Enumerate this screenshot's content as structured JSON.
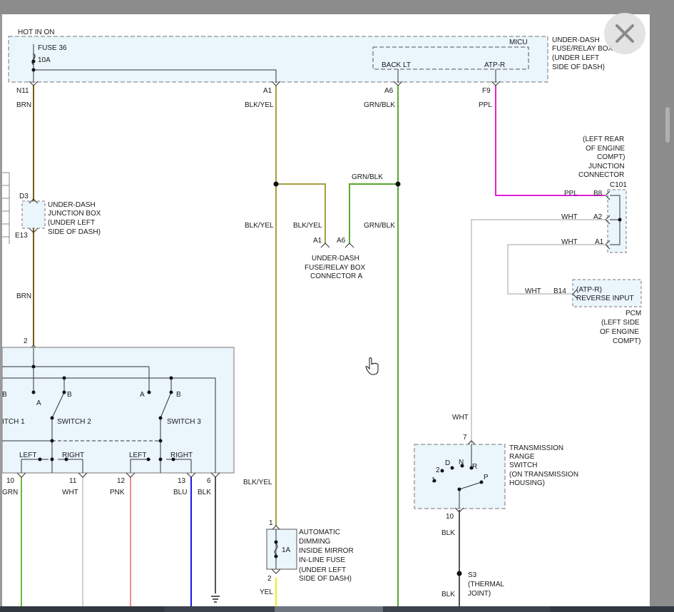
{
  "colors": {
    "brn": "#7a5a14",
    "blk_yel": "#a3a03a",
    "grn_blk": "#5aa832",
    "ppl": "#e020d8",
    "wht": "#d0d0d0",
    "grn": "#6ab83a",
    "pnk": "#f08a90",
    "blu": "#1a1ae6",
    "blk": "#555555",
    "yel": "#f2ec1e",
    "box_fill": "#eaf5fc",
    "box_stroke": "#777777"
  },
  "fuse_box": {
    "hot_label": "HOT IN ON",
    "fuse": "FUSE 36",
    "rating": "10A",
    "micu": "MICU",
    "back_lt": "BACK LT",
    "atp_r": "ATP-R",
    "desc": [
      "UNDER-DASH",
      "FUSE/RELAY BOX",
      "(UNDER LEFT",
      "SIDE OF DASH)"
    ]
  },
  "terminals": {
    "n11": "N11",
    "a1": "A1",
    "a6": "A6",
    "f9": "F9",
    "d3": "D3",
    "e13": "E13",
    "t2": "2",
    "c_a1": "A1",
    "c_a6": "A6",
    "c101": "C101",
    "b8": "B8",
    "a2": "A2",
    "cpin_a1": "A1",
    "b14": "B14",
    "m1": "1",
    "m2": "2",
    "t10": "10",
    "t11": "11",
    "t12": "12",
    "t13": "13",
    "t6": "6",
    "tr7": "7",
    "tr10": "10"
  },
  "wires": {
    "brn_top": "BRN",
    "brn_mid": "BRN",
    "blk_yel_top": "BLK/YEL",
    "blk_yel_mid": "BLK/YEL",
    "blk_yel_branch": "BLK/YEL",
    "blk_yel_low": "BLK/YEL",
    "grn_blk_top": "GRN/BLK",
    "grn_blk_branch": "GRN/BLK",
    "grn_blk_mid": "GRN/BLK",
    "ppl_top": "PPL",
    "ppl_c101": "PPL",
    "wht_a2": "WHT",
    "wht_a1": "WHT",
    "wht_b14": "WHT",
    "wht_tr": "WHT",
    "grn": "GRN",
    "wht": "WHT",
    "pnk": "PNK",
    "blu": "BLU",
    "blk": "BLK",
    "blk_tr": "BLK",
    "blk_s3": "BLK",
    "yel": "YEL"
  },
  "junction_box": [
    "UNDER-DASH",
    "JUNCTION BOX",
    "(UNDER LEFT",
    "SIDE OF DASH)"
  ],
  "connector_a": [
    "UNDER-DASH",
    "FUSE/RELAY BOX",
    "CONNECTOR A"
  ],
  "junction_connector": [
    "(LEFT REAR",
    "OF ENGINE",
    "COMPT)",
    "JUNCTION",
    "CONNECTOR"
  ],
  "pcm": {
    "box_lines": [
      "(ATP-R)",
      "REVERSE INPUT"
    ],
    "desc": [
      "PCM",
      "(LEFT SIDE",
      "OF ENGINE",
      "COMPT)"
    ]
  },
  "switch_module": {
    "switch1": "ITCH 1",
    "switch2": "SWITCH 2",
    "switch3": "SWITCH 3",
    "a": "A",
    "b": "B",
    "b_cut": "B",
    "left": "LEFT",
    "right": "RIGHT"
  },
  "mirror": {
    "fuse": "1A",
    "desc": [
      "AUTOMATIC",
      "DIMMING",
      "INSIDE MIRROR",
      "IN-LINE FUSE",
      "(UNDER LEFT",
      "SIDE OF DASH)"
    ]
  },
  "trans_switch": {
    "positions": {
      "d": "D",
      "n": "N",
      "r": "R",
      "p": "P",
      "two": "2",
      "one": "1"
    },
    "desc": [
      "TRANSMISSION",
      "RANGE",
      "SWITCH",
      "(ON TRANSMISSION",
      "HOUSING)"
    ]
  },
  "s3": [
    "S3",
    "(THERMAL",
    "JOINT)"
  ]
}
